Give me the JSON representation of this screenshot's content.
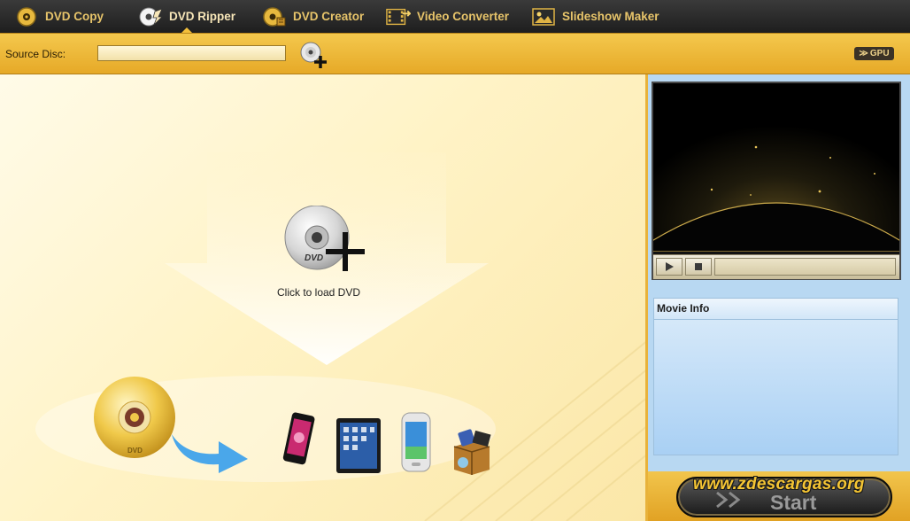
{
  "nav_tabs": [
    {
      "label": "DVD Copy",
      "icon": "dvd-copy-icon",
      "active": false
    },
    {
      "label": "DVD Ripper",
      "icon": "dvd-ripper-icon",
      "active": true
    },
    {
      "label": "DVD Creator",
      "icon": "dvd-creator-icon",
      "active": false
    },
    {
      "label": "Video Converter",
      "icon": "film-convert-icon",
      "active": false
    },
    {
      "label": "Slideshow Maker",
      "icon": "picture-icon",
      "active": false
    }
  ],
  "source": {
    "label": "Source Disc:",
    "value": ""
  },
  "gpu_badge": "GPU",
  "main": {
    "load_label": "Click to load DVD",
    "disc_text": "DVD"
  },
  "devices": [
    "iphone",
    "ipad",
    "samsung-phone",
    "multimedia-box"
  ],
  "movie_info": {
    "title": "Movie Info"
  },
  "start_label": "Start",
  "watermark": "www.zdescargas.org",
  "colors": {
    "accent": "#f3bf3a",
    "tab_text": "#e7c46a",
    "panel_blue": "#b8d8f2",
    "toolbar_dark": "#262626"
  }
}
